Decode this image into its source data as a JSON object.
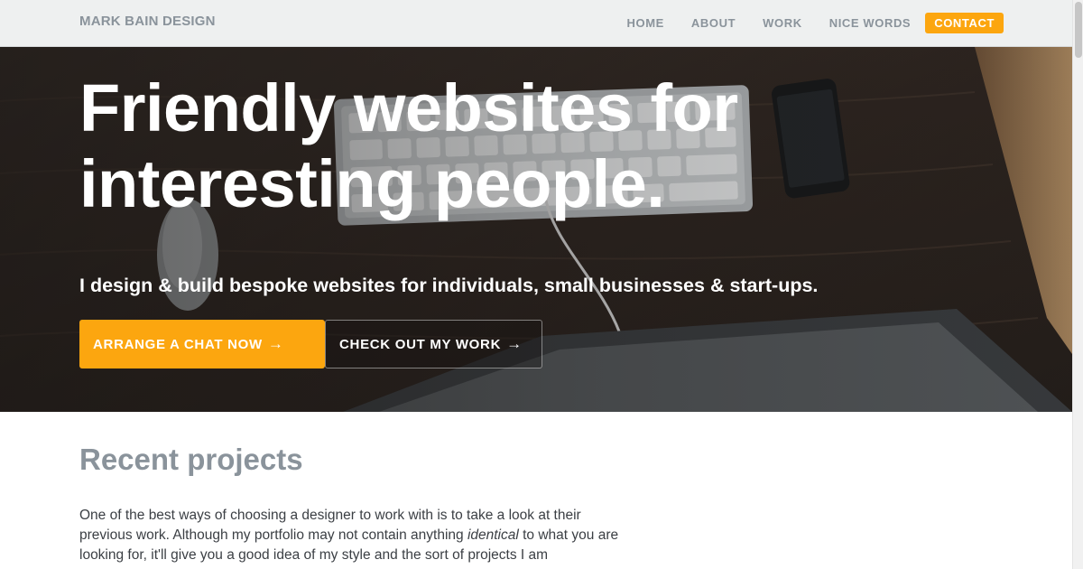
{
  "header": {
    "logo": "MARK BAIN DESIGN",
    "nav": {
      "home": "HOME",
      "about": "ABOUT",
      "work": "WORK",
      "nice_words": "NICE WORDS",
      "contact": "CONTACT"
    }
  },
  "hero": {
    "title_line1": "Friendly websites for",
    "title_line2": "interesting people.",
    "subtitle": "I design & build bespoke websites for individuals, small businesses & start-ups.",
    "primary_button": "ARRANGE A CHAT NOW",
    "secondary_button": "CHECK OUT MY WORK",
    "arrow": "→"
  },
  "projects": {
    "title": "Recent projects",
    "intro_part1": "One of the best ways of choosing a designer to work with is to take a look at their previous work. Although my portfolio may not contain anything ",
    "intro_emphasis": "identical",
    "intro_part2": " to what you are looking for, it'll give you a good idea of my style and the sort of projects I am"
  },
  "colors": {
    "accent": "#fca60f",
    "nav_text": "#8a939b",
    "header_bg": "#eef0f0",
    "body_text": "#3b3f44"
  }
}
